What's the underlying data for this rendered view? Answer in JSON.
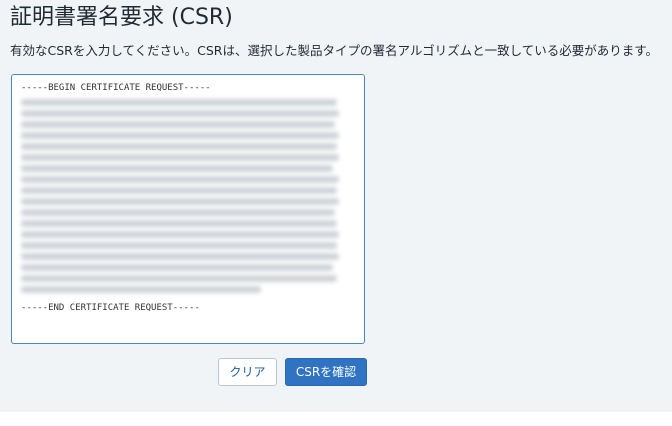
{
  "page": {
    "title": "証明書署名要求 (CSR)",
    "instruction": "有効なCSRを入力してください。CSRは、選択した製品タイプの署名アルゴリズムと一致している必要があります。"
  },
  "csr": {
    "begin_line": "-----BEGIN CERTIFICATE REQUEST-----",
    "end_line": "-----END CERTIFICATE REQUEST-----"
  },
  "buttons": {
    "clear_label": "クリア",
    "confirm_label": "CSRを確認"
  },
  "colors": {
    "accent": "#2f73c2",
    "input_border": "#4a86c8",
    "background": "#f1f4f7"
  }
}
